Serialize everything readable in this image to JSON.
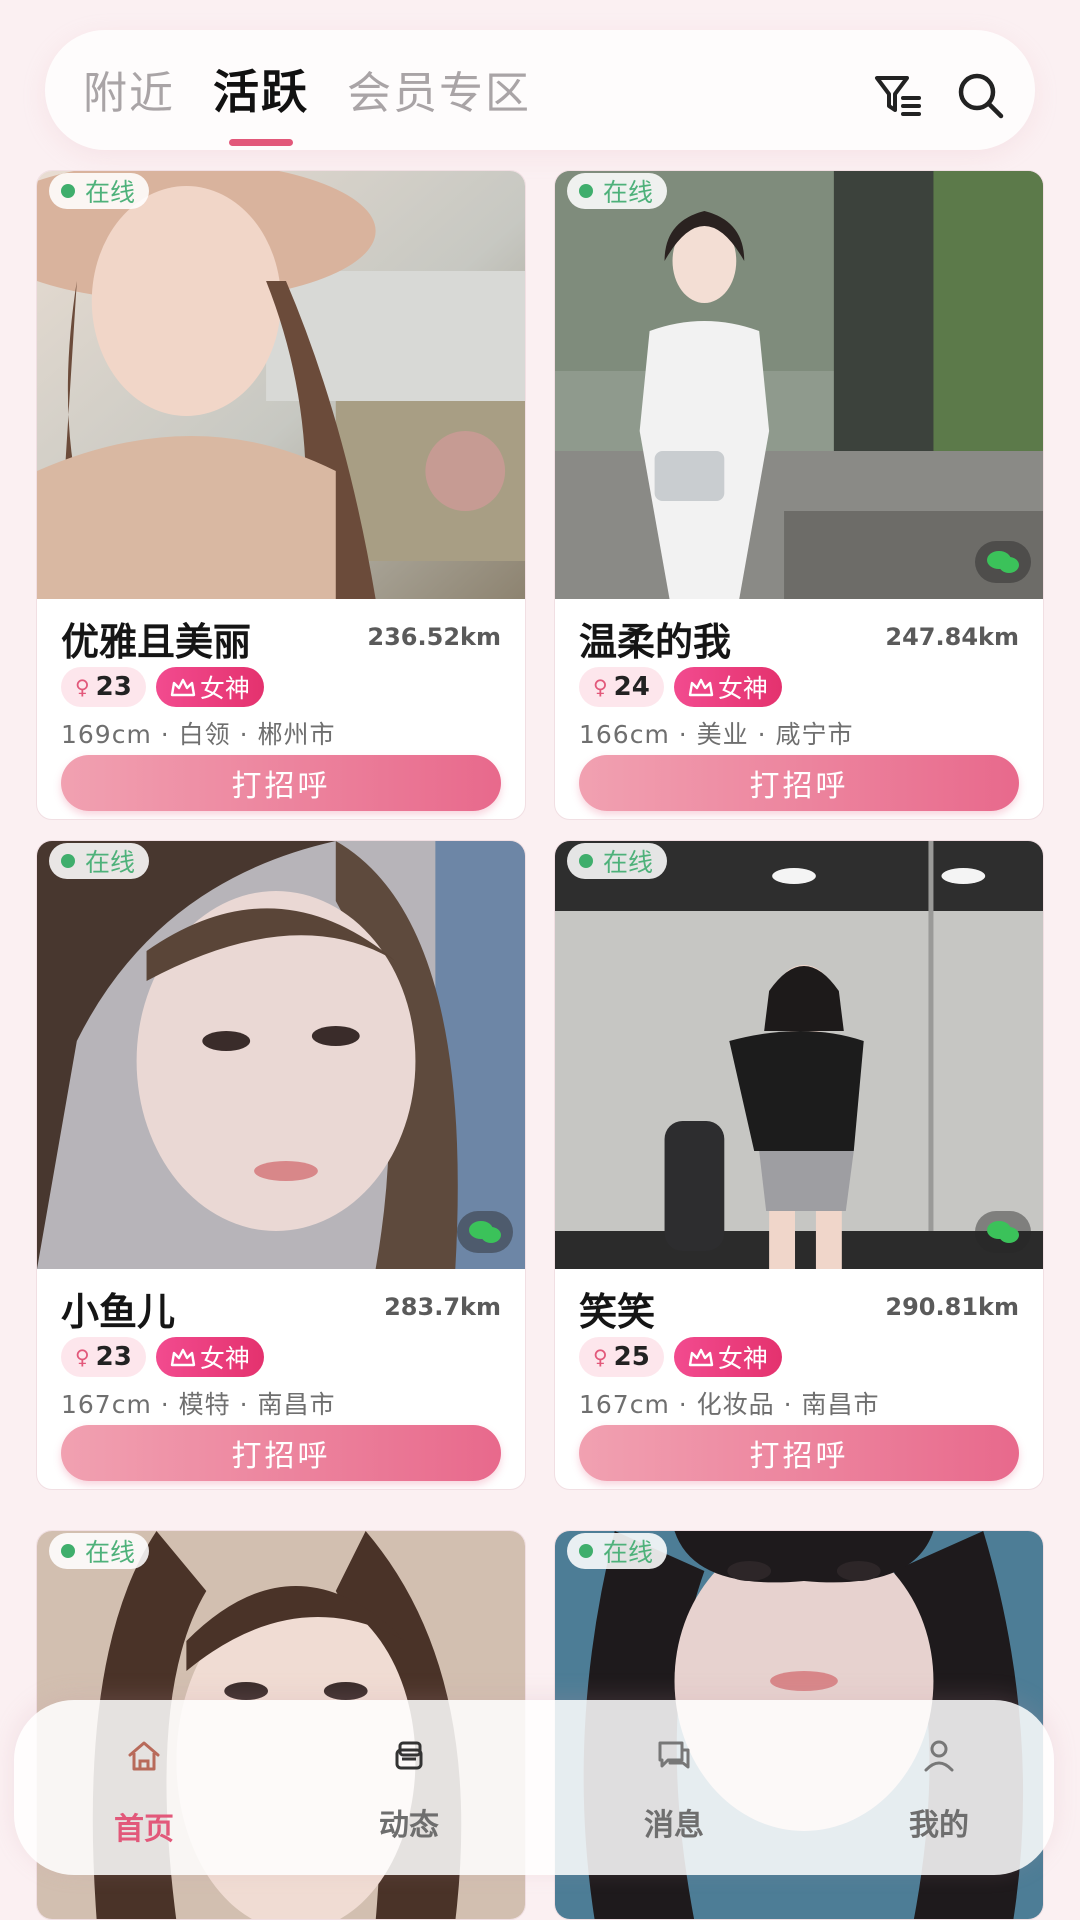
{
  "header": {
    "tabs": [
      {
        "label": "附近",
        "active": false
      },
      {
        "label": "活跃",
        "active": true
      },
      {
        "label": "会员专区",
        "active": false
      }
    ],
    "icons": [
      "filter-icon",
      "search-icon"
    ],
    "accent_color": "#e2587a"
  },
  "online_label": "在线",
  "greet_label": "打招呼",
  "goddess_label": "女神",
  "cards": [
    {
      "name": "优雅且美丽",
      "distance": "236.52km",
      "age": "23",
      "info": "169cm · 白领 · 郴州市"
    },
    {
      "name": "温柔的我",
      "distance": "247.84km",
      "age": "24",
      "info": "166cm · 美业 · 咸宁市"
    },
    {
      "name": "小鱼儿",
      "distance": "283.7km",
      "age": "23",
      "info": "167cm · 模特 · 南昌市"
    },
    {
      "name": "笑笑",
      "distance": "290.81km",
      "age": "25",
      "info": "167cm · 化妆品 · 南昌市"
    }
  ],
  "nav": {
    "items": [
      {
        "label": "首页",
        "icon": "home-icon",
        "active": true
      },
      {
        "label": "动态",
        "icon": "moments-icon",
        "active": false
      },
      {
        "label": "消息",
        "icon": "message-icon",
        "active": false
      },
      {
        "label": "我的",
        "icon": "profile-icon",
        "active": false
      }
    ]
  }
}
